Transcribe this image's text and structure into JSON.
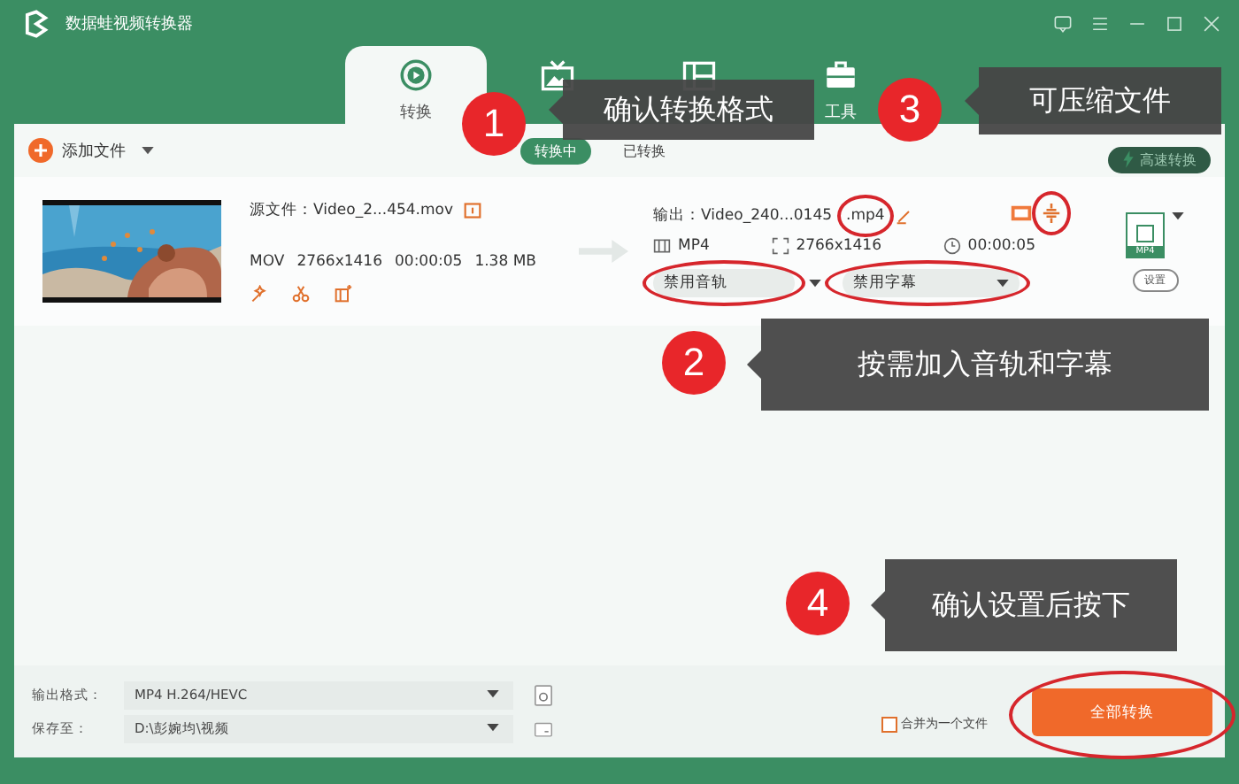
{
  "window": {
    "title": "数据蛙视频转换器"
  },
  "tabs": [
    {
      "kind": "convert",
      "label": "转换",
      "selected": true
    },
    {
      "kind": "tv",
      "selected": false
    },
    {
      "kind": "split",
      "selected": false
    },
    {
      "kind": "toolbox",
      "label": "工具",
      "selected": false
    }
  ],
  "toolbar": {
    "add_button": "添加文件",
    "subtabs": [
      {
        "label": "转换中",
        "selected": true
      },
      {
        "label": "已转换",
        "selected": false
      }
    ],
    "speed_button": "高速转换"
  },
  "file": {
    "source": "源文件：Video_2...454.mov",
    "meta": [
      "MOV",
      "2766x1416",
      "00:00:05",
      "1.38 MB"
    ],
    "output": "输出：Video_240...0145",
    "output_ext": ".mp4",
    "out_format": "MP4",
    "out_size": "2766x1416",
    "out_duration": "00:00:05",
    "audio": "禁用音轨",
    "subtitle": "禁用字幕",
    "format_badge": "MP4",
    "settings": "设置"
  },
  "bottom": {
    "format_label": "输出格式：",
    "format": "MP4 H.264/HEVC",
    "save_label": "保存至：",
    "path": "D:\\彭婉均\\视频",
    "merge": {
      "label": "合并为一个文件",
      "checked": false
    },
    "convert_all": "全部转换"
  },
  "callouts": [
    {
      "number": "1",
      "text": "确认转换格式"
    },
    {
      "number": "3",
      "text": "可压缩文件"
    },
    {
      "number": "2",
      "text": "按需加入音轨和字幕"
    },
    {
      "number": "4",
      "text": "确认设置后按下"
    }
  ]
}
